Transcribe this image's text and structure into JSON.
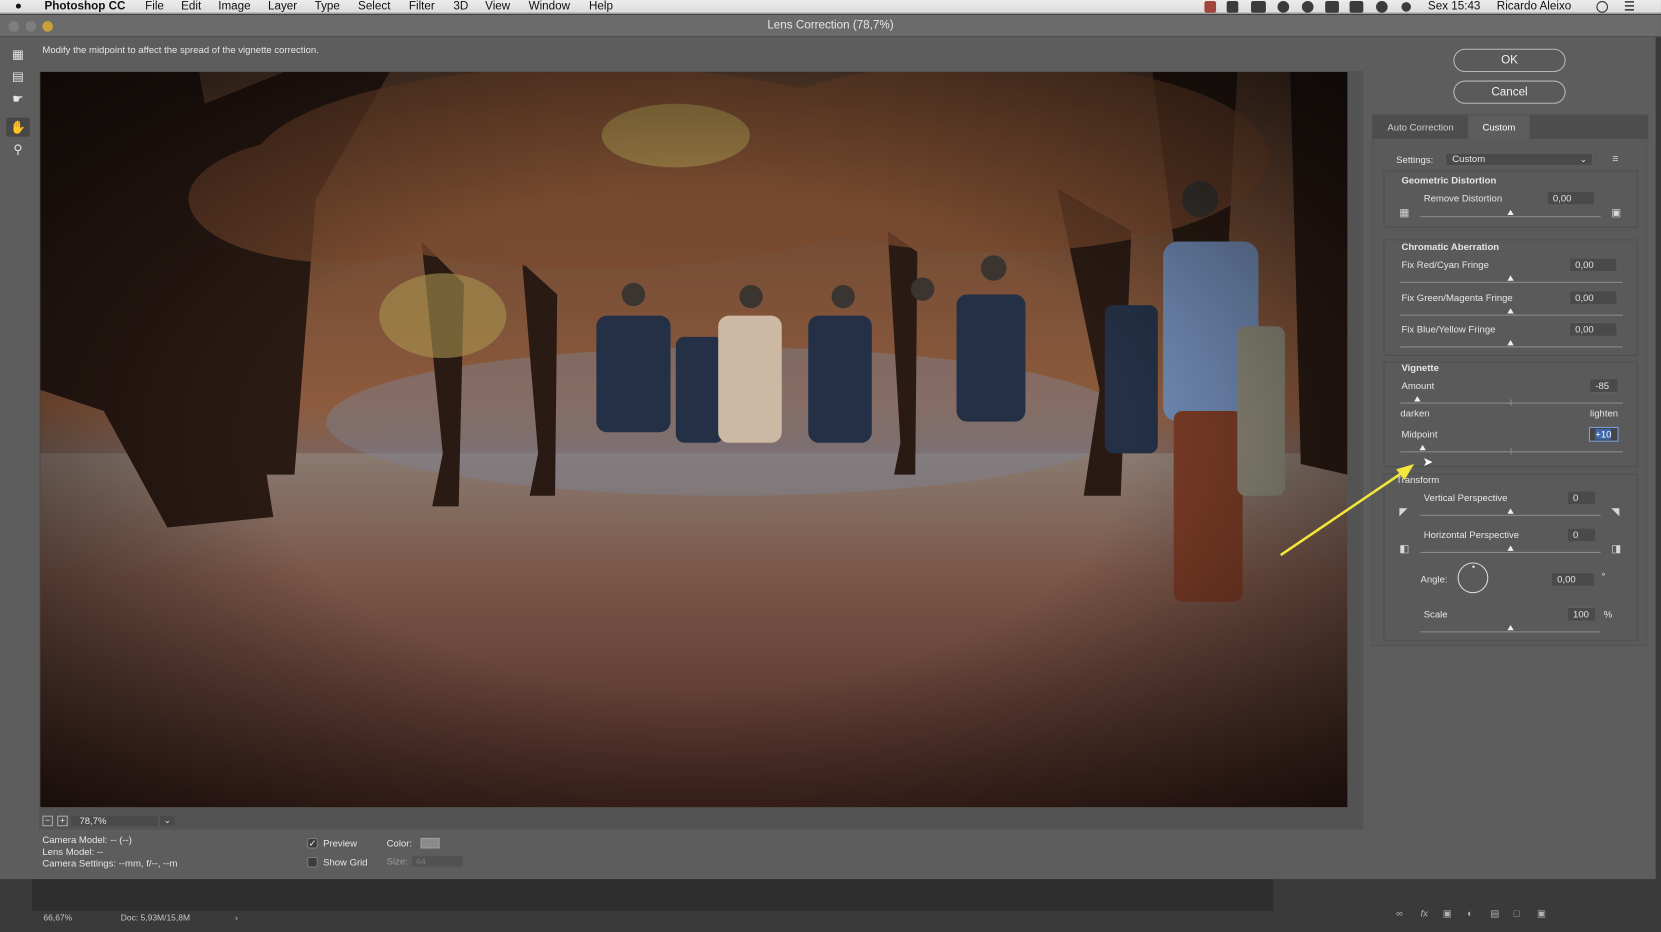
{
  "menubar": {
    "apple": "",
    "app_name": "Photoshop CC",
    "items": [
      "File",
      "Edit",
      "Image",
      "Layer",
      "Type",
      "Select",
      "Filter",
      "3D",
      "View",
      "Window",
      "Help"
    ],
    "clock": "Sex 15:43",
    "user": "Ricardo Aleixo"
  },
  "window": {
    "title": "Lens Correction (78,7%)"
  },
  "hint": "Modify the midpoint to affect the spread of the vignette correction.",
  "tools": [
    "remove-distortion-tool",
    "straighten-tool",
    "move-grid-tool",
    "hand-tool",
    "zoom-tool"
  ],
  "buttons": {
    "ok": "OK",
    "cancel": "Cancel"
  },
  "zoom": {
    "value": "78,7%"
  },
  "camera_info": {
    "camera_model": "Camera Model: -- (--)",
    "lens_model": "Lens Model: --",
    "camera_settings": "Camera Settings: --mm, f/--, --m"
  },
  "preview": {
    "label": "Preview",
    "checked": "✓"
  },
  "show_grid": {
    "label": "Show Grid"
  },
  "color": {
    "label": "Color:",
    "value": "#8a8a8a"
  },
  "size": {
    "label": "Size:",
    "value": "64"
  },
  "tabs": {
    "auto": "Auto Correction",
    "custom": "Custom"
  },
  "settings": {
    "label": "Settings:",
    "value": "Custom"
  },
  "geometric": {
    "title": "Geometric Distortion",
    "remove_label": "Remove Distortion",
    "remove_value": "0,00"
  },
  "chromatic": {
    "title": "Chromatic Aberration",
    "red_cyan_label": "Fix Red/Cyan Fringe",
    "red_cyan_value": "0,00",
    "green_magenta_label": "Fix Green/Magenta Fringe",
    "green_magenta_value": "0,00",
    "blue_yellow_label": "Fix Blue/Yellow Fringe",
    "blue_yellow_value": "0,00"
  },
  "vignette": {
    "title": "Vignette",
    "amount_label": "Amount",
    "amount_value": "-85",
    "amount_level": -85,
    "darken": "darken",
    "lighten": "lighten",
    "midpoint_label": "Midpoint",
    "midpoint_value": "+10",
    "midpoint_level": 10
  },
  "transform": {
    "title": "Transform",
    "vertical_label": "Vertical Perspective",
    "vertical_value": "0",
    "horizontal_label": "Horizontal Perspective",
    "horizontal_value": "0",
    "angle_label": "Angle:",
    "angle_value": "0,00",
    "angle_unit": "°",
    "scale_label": "Scale",
    "scale_value": "100",
    "scale_unit": "%"
  },
  "status": {
    "zoom": "66,67%",
    "doc": "Doc: 5,93M/15,8M"
  },
  "colors": {
    "annotation_arrow": "#f2e73a",
    "accent": "#3f66a8"
  }
}
